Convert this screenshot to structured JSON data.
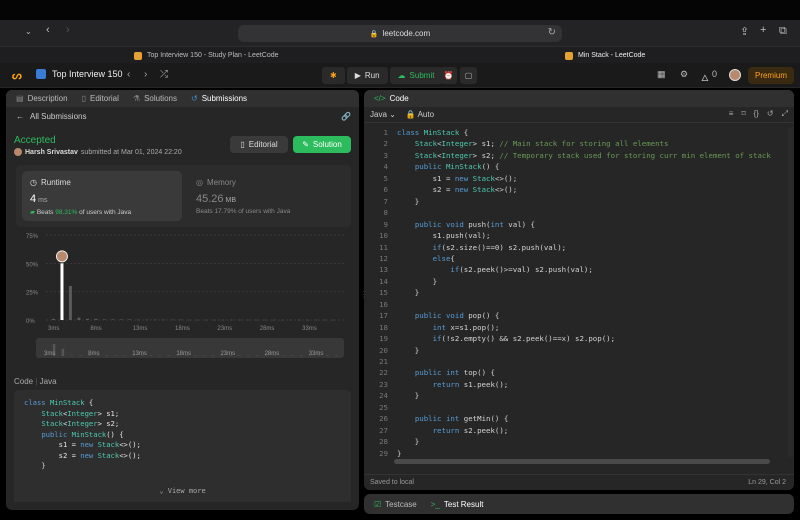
{
  "browser": {
    "url": "leetcode.com",
    "tabs": [
      {
        "title": "Top Interview 150 - Study Plan - LeetCode"
      },
      {
        "title": "Min Stack - LeetCode"
      }
    ]
  },
  "header": {
    "plan_title": "Top Interview 150",
    "run_label": "Run",
    "submit_label": "Submit",
    "streak_count": "0",
    "premium_label": "Premium"
  },
  "left_panel": {
    "tabs": [
      "Description",
      "Editorial",
      "Solutions",
      "Submissions"
    ],
    "back_label": "All Submissions",
    "status": "Accepted",
    "author": "Harsh Srivastav",
    "submitted_text": "submitted at Mar 01, 2024 22:20",
    "editorial_btn": "Editorial",
    "solution_btn": "Solution",
    "runtime": {
      "label": "Runtime",
      "value": "4",
      "unit": "ms",
      "beats_label": "Beats",
      "beats_pct": "98.31%",
      "beats_suffix": "of users with Java"
    },
    "memory": {
      "label": "Memory",
      "value": "45.26",
      "unit": "MB",
      "beats_label": "Beats",
      "beats_pct": "17.79%",
      "beats_suffix": "of users with Java"
    },
    "code_label": "Code",
    "code_lang": "Java",
    "code_preview": [
      "class MinStack {",
      "    Stack<Integer> s1;",
      "    Stack<Integer> s2;",
      "    public MinStack() {",
      "        s1 = new Stack<>();",
      "        s2 = new Stack<>();",
      "    }"
    ],
    "view_more": "View more"
  },
  "chart_data": {
    "type": "bar",
    "ylabel": "",
    "yticks": [
      "75%",
      "50%",
      "25%",
      "0%"
    ],
    "ylim": [
      0,
      75
    ],
    "categories": [
      "3ms",
      "4ms",
      "5ms",
      "6ms",
      "7ms",
      "8ms",
      "9ms",
      "10ms",
      "11ms",
      "12ms",
      "13ms",
      "14ms",
      "15ms",
      "16ms",
      "17ms",
      "18ms",
      "19ms",
      "20ms",
      "21ms",
      "22ms",
      "23ms",
      "24ms",
      "25ms",
      "26ms",
      "27ms",
      "28ms",
      "29ms",
      "30ms",
      "31ms",
      "32ms",
      "33ms",
      "34ms",
      "35ms",
      "36ms"
    ],
    "values": [
      1,
      50,
      30,
      2,
      1,
      1,
      0.5,
      0.5,
      0.5,
      0.5,
      0.3,
      0.3,
      0.3,
      0.3,
      0.3,
      0.3,
      0.2,
      0.2,
      0.2,
      0.2,
      0.2,
      0.2,
      0.2,
      0.2,
      0.2,
      0.2,
      0.2,
      0.2,
      0.2,
      0.2,
      0.2,
      0.2,
      0.2,
      0.2
    ],
    "xtick_labels": [
      "3ms",
      "8ms",
      "13ms",
      "18ms",
      "23ms",
      "28ms",
      "33ms"
    ],
    "highlight_category": "4ms",
    "colors": {
      "bar": "#5a5a5a",
      "highlight": "#ffffff"
    }
  },
  "editor": {
    "tab_label": "Code",
    "language": "Java",
    "mode": "Auto",
    "status_left": "Saved to local",
    "status_right": "Ln 29, Col 2",
    "lines": [
      "class MinStack {",
      "    Stack<Integer> s1; // Main stack for storing all elements",
      "    Stack<Integer> s2; // Temporary stack used for storing curr min element of stack",
      "    public MinStack() {",
      "        s1 = new Stack<>();",
      "        s2 = new Stack<>();",
      "    }",
      "",
      "    public void push(int val) {",
      "        s1.push(val);",
      "        if(s2.size()==0) s2.push(val);",
      "        else{",
      "            if(s2.peek()>=val) s2.push(val);",
      "        }",
      "    }",
      "",
      "    public void pop() {",
      "        int x=s1.pop();",
      "        if(!s2.empty() && s2.peek()==x) s2.pop();",
      "    }",
      "",
      "    public int top() {",
      "        return s1.peek();",
      "    }",
      "",
      "    public int getMin() {",
      "        return s2.peek();",
      "    }",
      "}"
    ]
  },
  "bottom_panel": {
    "tabs": [
      "Testcase",
      "Test Result"
    ]
  }
}
